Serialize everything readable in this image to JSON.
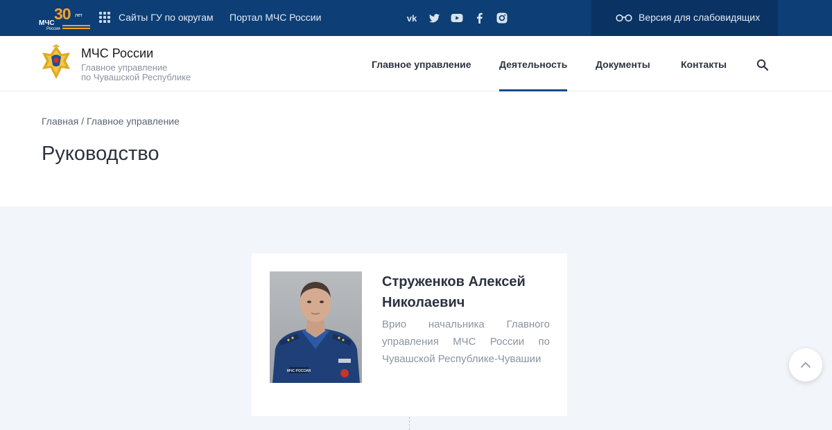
{
  "topbar": {
    "logo": {
      "number": "30",
      "suffix": "лет",
      "brand": "МЧС",
      "sub": "России"
    },
    "links": [
      "Сайты ГУ по округам",
      "Портал МЧС России"
    ],
    "socials": [
      "vk-icon",
      "twitter-icon",
      "youtube-icon",
      "facebook-icon",
      "instagram-icon"
    ],
    "accessibility_label": "Версия для слабовидящих",
    "colors": {
      "bar": "#0d3e75",
      "accessibility_bg": "#0a3363",
      "logo_accent": "#f7a226"
    }
  },
  "header": {
    "title": "МЧС России",
    "subtitle_line1": "Главное управление",
    "subtitle_line2": "по Чувашской Республике",
    "nav": [
      "Главное управление",
      "Деятельность",
      "Документы",
      "Контакты"
    ],
    "active_nav": "Деятельность"
  },
  "breadcrumb": {
    "home": "Главная",
    "separator": "/",
    "current": "Главное управление"
  },
  "page": {
    "title": "Руководство"
  },
  "person": {
    "name": "Струженков Алексей Николаевич",
    "position": "Врио начальника Главного управления МЧС России по Чувашской Республике-Чувашии",
    "patch_text": "МЧС РОССИИ"
  }
}
